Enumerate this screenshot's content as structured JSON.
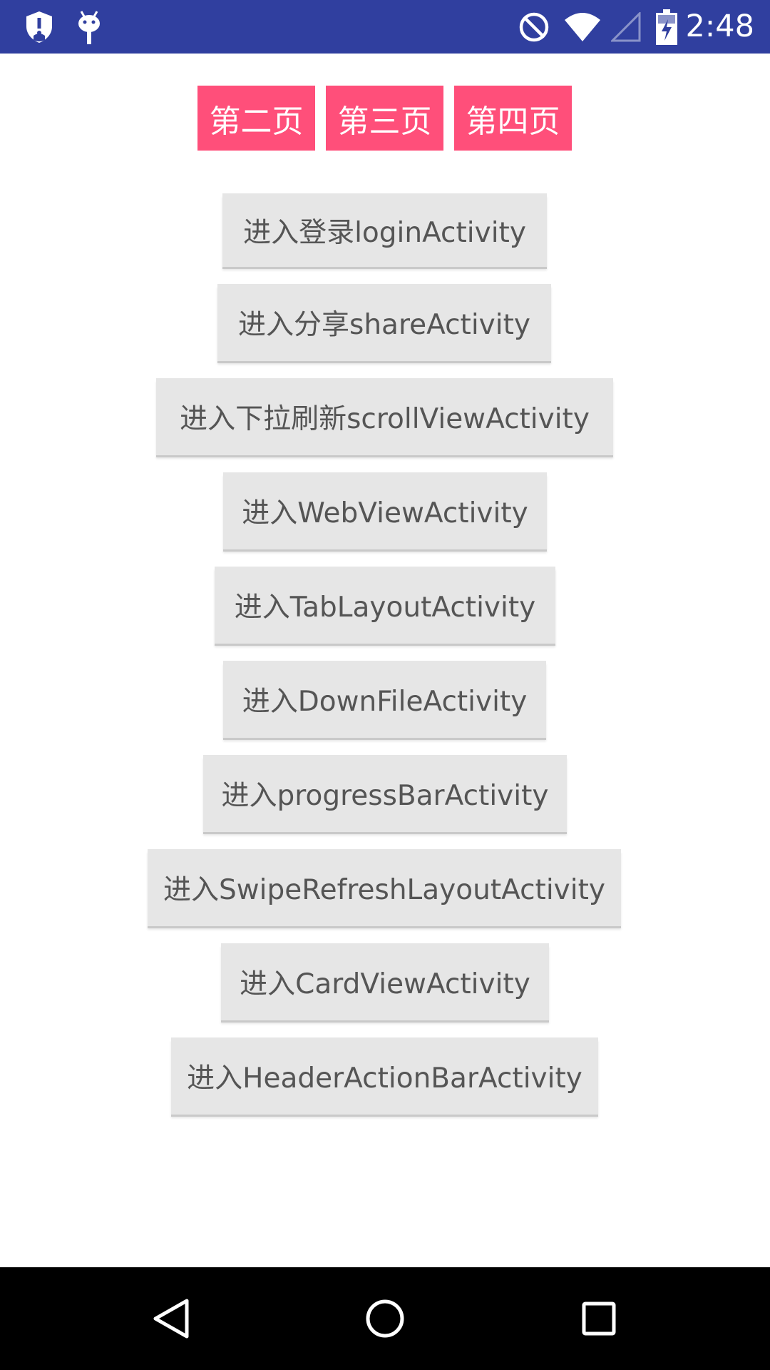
{
  "status_bar": {
    "time": "2:48",
    "background": "#303F9F",
    "left_icons": [
      "shield-alert-icon",
      "android-debug-icon"
    ],
    "right_icons": [
      "do-not-disturb-icon",
      "wifi-icon",
      "cell-signal-icon",
      "battery-charging-icon"
    ]
  },
  "tabs": [
    {
      "label": "第二页"
    },
    {
      "label": "第三页"
    },
    {
      "label": "第四页"
    }
  ],
  "tab_color": "#FF4F7A",
  "buttons": [
    {
      "label": "进入登录loginActivity"
    },
    {
      "label": "进入分享shareActivity"
    },
    {
      "label": "进入下拉刷新scrollViewActivity"
    },
    {
      "label": "进入WebViewActivity"
    },
    {
      "label": "进入TabLayoutActivity"
    },
    {
      "label": "进入DownFileActivity"
    },
    {
      "label": "进入progressBarActivity"
    },
    {
      "label": "进入SwipeRefreshLayoutActivity"
    },
    {
      "label": "进入CardViewActivity"
    },
    {
      "label": "进入HeaderActionBarActivity"
    }
  ],
  "nav_bar": {
    "icons": [
      "back-icon",
      "home-icon",
      "recents-icon"
    ]
  }
}
